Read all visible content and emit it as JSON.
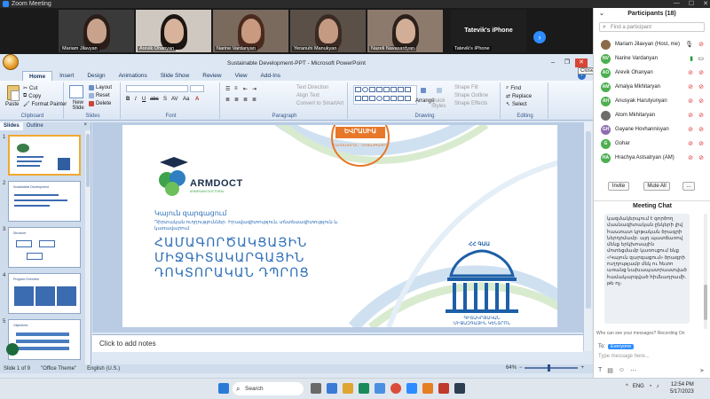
{
  "window": {
    "title": "Zoom Meeting",
    "min": "—",
    "max": "☐",
    "close": "✕"
  },
  "video": {
    "tiles": [
      {
        "name": "Mariam Jilavyan"
      },
      {
        "name": "Arevik Ohanyan"
      },
      {
        "name": "Narine Vardanyan"
      },
      {
        "name": "Yeranuhi Manukyan"
      },
      {
        "name": "Nazeli Navasardyan"
      },
      {
        "name": "Tatevik's iPhone",
        "big": "Tatevik's iPhone"
      }
    ]
  },
  "ppt": {
    "title": "Sustainable Development-PPT - Microsoft PowerPoint",
    "close_tooltip": "Close",
    "tabs": [
      "Home",
      "Insert",
      "Design",
      "Animations",
      "Slide Show",
      "Review",
      "View",
      "Add-Ins"
    ],
    "ribbon": {
      "clipboard": {
        "paste": "Paste",
        "cut": "Cut",
        "copy": "Copy",
        "format_painter": "Format Painter",
        "label": "Clipboard"
      },
      "slides": {
        "new_slide": "New Slide",
        "layout": "Layout",
        "reset": "Reset",
        "delete": "Delete",
        "label": "Slides"
      },
      "font": {
        "label": "Font"
      },
      "paragraph": {
        "text_direction": "Text Direction",
        "align_text": "Align Text",
        "convert": "Convert to SmartArt",
        "label": "Paragraph"
      },
      "drawing": {
        "arrange": "Arrange",
        "quick_styles": "Quick Styles",
        "shape_fill": "Shape Fill",
        "shape_outline": "Shape Outline",
        "shape_effects": "Shape Effects",
        "label": "Drawing"
      },
      "editing": {
        "find": "Find",
        "replace": "Replace",
        "select": "Select",
        "label": "Editing"
      }
    },
    "slides_panel": {
      "tab_slides": "Slides",
      "tab_outline": "Outline",
      "close": "×",
      "numbers": [
        "1",
        "2",
        "3",
        "4",
        "5"
      ]
    },
    "slide": {
      "logo_word": "ARMDOCT",
      "logo_sub": "ARMENIAN DOCTORAL",
      "stamp_word": "ԵՎՐԱՍԻԱ",
      "stamp_ring": "ՀԱՄԱԼՍԱՐԱՆ · ՄԻՋԱԶԳԱՅԻՆ ·",
      "subtitle": "Կայուն զարգացում",
      "description": "Դիրտական ուղղություններ․ Իրավագիտություն, տնտեսագիտություն և կառավարում",
      "headline1": "ՀԱՄԱԳՈՐԾԱԿՑԱՅԻՆ",
      "headline2": "ՄԻՋԳԻՏԱԿԱՐԳԱՅԻՆ",
      "headline3": "ԴՈԿՏՈՐԱԿԱՆ ԴՊՐՈՑ",
      "academy_top": "ՀՀ ԳԱԱ",
      "academy_line1": "ԳԻՏԱԿՐԹԱԿԱՆ",
      "academy_line2": "ՄԻՋԱԶԳԱՅԻՆ ԿԵՆՏՐՈՆ"
    },
    "notes_placeholder": "Click to add notes",
    "status": {
      "slide_of": "Slide 1 of 9",
      "theme": "\"Office Theme\"",
      "lang": "English (U.S.)",
      "zoom": "64%"
    }
  },
  "participants": {
    "title": "Participants (18)",
    "search_placeholder": "Find a participant",
    "list": [
      {
        "name": "Mariam Jilavyan (Host, me)",
        "color": "#8a6b4a",
        "initials": "",
        "mic_ok": true,
        "cam_ok": false
      },
      {
        "name": "Narine Vardanyan",
        "color": "#4caf50",
        "initials": "NV",
        "mic_ok": true,
        "cam_ok": true
      },
      {
        "name": "Arevik Ohanyan",
        "color": "#4caf50",
        "initials": "AO",
        "mic_ok": false,
        "cam_ok": false
      },
      {
        "name": "Amalya Mkhitaryan",
        "color": "#4caf50",
        "initials": "AM",
        "mic_ok": false,
        "cam_ok": false
      },
      {
        "name": "Anusyak Harutyunyan",
        "color": "#4caf50",
        "initials": "AH",
        "mic_ok": false,
        "cam_ok": false
      },
      {
        "name": "Atom Mkhitaryan",
        "color": "#6d6d6d",
        "initials": "",
        "mic_ok": false,
        "cam_ok": false
      },
      {
        "name": "Gayane Hovhannisyan",
        "color": "#8e6bb0",
        "initials": "GH",
        "mic_ok": false,
        "cam_ok": false
      },
      {
        "name": "Gohar",
        "color": "#4caf50",
        "initials": "G",
        "mic_ok": false,
        "cam_ok": false
      },
      {
        "name": "Hrachya Astsatryan (AM)",
        "color": "#4caf50",
        "initials": "HA",
        "mic_ok": false,
        "cam_ok": false
      }
    ],
    "invite": "Invite",
    "mute_all": "Mute All",
    "more": "..."
  },
  "chat": {
    "title": "Meeting Chat",
    "message": "կազմակերպում է գործող մասնագիտական ընկերի լիվ հաստատ կրթական ծրագրի ներդրմամբ. այդ պատճառով մենք երկխոսային մոտեցմամբ կառուցում ենք «Կայուն զարգացում» ծրագրի ուղղությամբ մեկ ու հետո առանց նախապատրաստված համակարգված հիմնադրամի. թե ոչ։",
    "info": "Who can see your messages? Recording On",
    "to_label": "To:",
    "to_value": "Everyone",
    "input_placeholder": "Type message here..."
  },
  "taskbar": {
    "search": "Search",
    "lang": "ENG",
    "time": "12:54 PM",
    "date": "5/17/2023"
  }
}
